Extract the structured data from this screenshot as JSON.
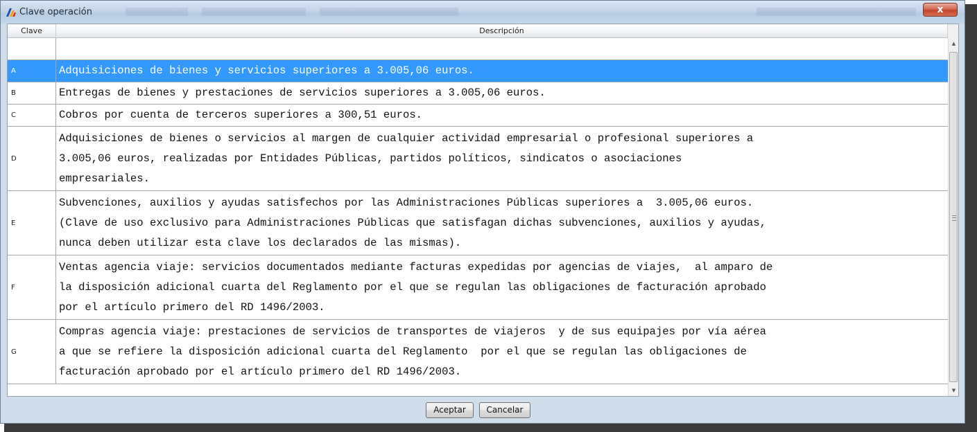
{
  "window": {
    "title": "Clave operación",
    "close_label": "x"
  },
  "table": {
    "headers": [
      "Clave",
      "Descripción"
    ],
    "selected_row": 0,
    "rows": [
      {
        "key": "A",
        "lines": [
          "Adquisiciones de bienes y servicios superiores a 3.005,06 euros."
        ]
      },
      {
        "key": "B",
        "lines": [
          "Entregas de bienes y prestaciones de servicios superiores a 3.005,06 euros."
        ]
      },
      {
        "key": "C",
        "lines": [
          "Cobros por cuenta de terceros superiores a 300,51 euros."
        ]
      },
      {
        "key": "D",
        "lines": [
          "Adquisiciones de bienes o servicios al margen de cualquier actividad empresarial o profesional superiores a",
          "3.005,06 euros, realizadas por Entidades Públicas, partidos políticos, sindicatos o asociaciones",
          "empresariales."
        ]
      },
      {
        "key": "E",
        "lines": [
          "Subvenciones, auxilios y ayudas satisfechos por las Administraciones Públicas superiores a  3.005,06 euros.",
          "(Clave de uso exclusivo para Administraciones Públicas que satisfagan dichas subvenciones, auxilios y ayudas,",
          "nunca deben utilizar esta clave los declarados de las mismas)."
        ]
      },
      {
        "key": "F",
        "lines": [
          "Ventas agencia viaje: servicios documentados mediante facturas expedidas por agencias de viajes,  al amparo de",
          "la disposición adicional cuarta del Reglamento por el que se regulan las obligaciones de facturación aprobado",
          "por el artículo primero del RD 1496/2003."
        ]
      },
      {
        "key": "G",
        "lines": [
          "Compras agencia viaje: prestaciones de servicios de transportes de viajeros  y de sus equipajes por vía aérea",
          "a que se refiere la disposición adicional cuarta del Reglamento  por el que se regulan las obligaciones de",
          "facturación aprobado por el artículo primero del RD 1496/2003."
        ]
      }
    ]
  },
  "buttons": {
    "accept": "Aceptar",
    "cancel": "Cancelar"
  },
  "colors": {
    "selection": "#3399ff",
    "close_button": "#c2432b"
  }
}
